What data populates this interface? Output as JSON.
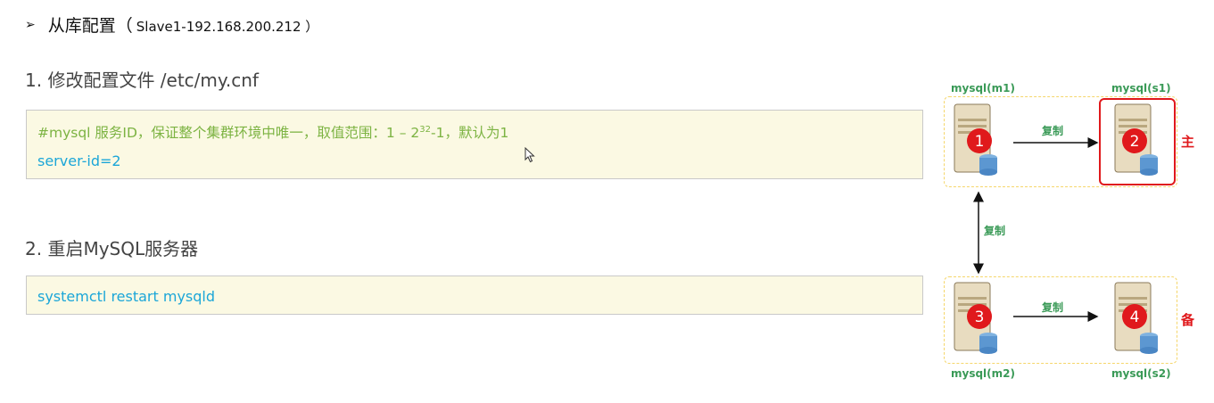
{
  "heading": {
    "bullet": "➢",
    "title": "从库配置（",
    "ip": "Slave1-192.168.200.212 ）"
  },
  "step1": {
    "label": "1. 修改配置文件 /etc/my.cnf",
    "comment_main": "#mysql 服务ID，保证整个集群环境中唯一，取值范围：1 – 2",
    "comment_sup": "32",
    "comment_tail": "-1，默认为1",
    "code": "server-id=2"
  },
  "step2": {
    "label": "2. 重启MySQL服务器",
    "code": "systemctl  restart  mysqld"
  },
  "diagram": {
    "servers": [
      {
        "name": "mysql(m1)",
        "num": "1"
      },
      {
        "name": "mysql(s1)",
        "num": "2"
      },
      {
        "name": "mysql(m2)",
        "num": "3"
      },
      {
        "name": "mysql(s2)",
        "num": "4"
      }
    ],
    "replicate_label": "复制",
    "primary_label": "主",
    "backup_label": "备"
  },
  "colors": {
    "code_bg": "#fbf9e3",
    "comment_green": "#7cb342",
    "code_blue": "#1ba6d8",
    "diagram_green": "#3a9a57",
    "red": "#e0191c"
  }
}
